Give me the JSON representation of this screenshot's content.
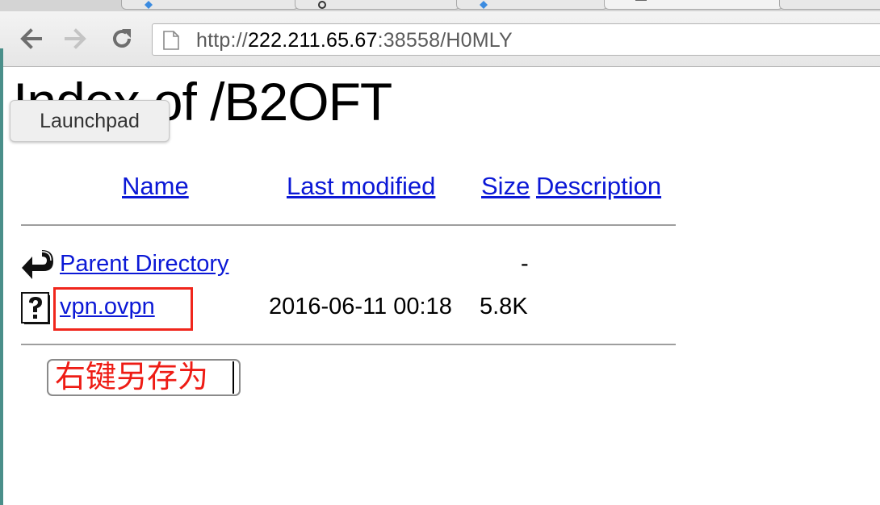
{
  "browser": {
    "back_icon": "arrow-left-icon",
    "forward_icon": "arrow-right-icon",
    "reload_icon": "reload-icon",
    "url_prefix": "http://",
    "url_host": "222.211.65.67",
    "url_rest": ":38558/H0MLY"
  },
  "page": {
    "title": "Index of /B2OFT"
  },
  "launchpad": {
    "label": "Launchpad"
  },
  "listing": {
    "headers": {
      "name": "Name",
      "last_modified": "Last modified",
      "size": "Size",
      "description": "Description"
    },
    "rows": [
      {
        "name": "Parent Directory",
        "last_modified": "",
        "size": "-",
        "icon": "back-arrow-icon"
      },
      {
        "name": "vpn.ovpn",
        "last_modified": "2016-06-11 00:18",
        "size": "5.8K",
        "icon": "unknown-file-icon"
      }
    ]
  },
  "annotation": {
    "text": "右键另存为",
    "color": "#ee1c15",
    "highlight_color": "#f0261c"
  }
}
